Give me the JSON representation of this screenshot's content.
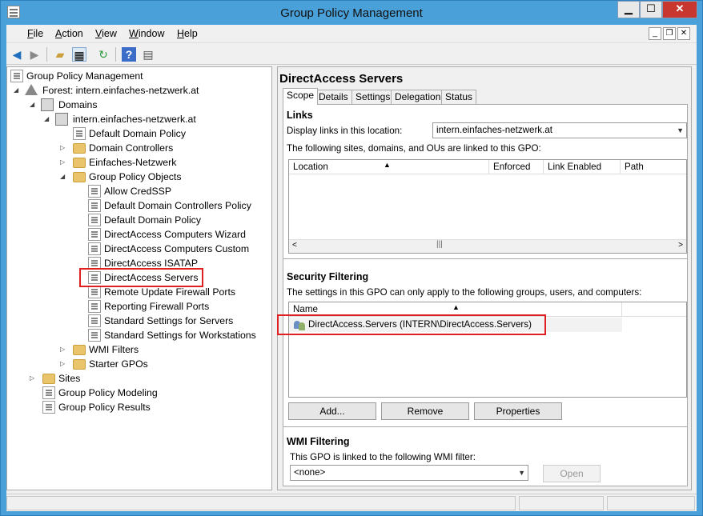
{
  "window": {
    "title": "Group Policy Management",
    "min": "▁",
    "max": "☐",
    "close": "✕"
  },
  "menu": [
    {
      "label": "File",
      "key": "F",
      "rest": "ile"
    },
    {
      "label": "Action",
      "key": "A",
      "rest": "ction"
    },
    {
      "label": "View",
      "key": "V",
      "rest": "iew"
    },
    {
      "label": "Window",
      "key": "W",
      "rest": "indow"
    },
    {
      "label": "Help",
      "key": "H",
      "rest": "elp"
    }
  ],
  "toolbar": {
    "icons": [
      "back-arrow-icon",
      "forward-arrow-icon",
      "up-folder-icon",
      "show-hide-tree-icon",
      "refresh-icon",
      "help-icon",
      "properties-icon"
    ]
  },
  "tree": {
    "root": "Group Policy Management",
    "forest": "Forest: intern.einfaches-netzwerk.at",
    "domains": "Domains",
    "domain": "intern.einfaches-netzwerk.at",
    "default_domain_policy": "Default Domain Policy",
    "domain_controllers": "Domain Controllers",
    "einfaches_netzwerk": "Einfaches-Netzwerk",
    "gpo_container": "Group Policy Objects",
    "gpos": [
      "Allow CredSSP",
      "Default Domain Controllers Policy",
      "Default Domain Policy",
      "DirectAccess Computers Wizard",
      "DirectAccess Computers Custom",
      "DirectAccess ISATAP",
      "DirectAccess Servers",
      "Remote Update Firewall Ports",
      "Reporting Firewall Ports",
      "Standard Settings for Servers",
      "Standard Settings for Workstations"
    ],
    "wmi_filters": "WMI Filters",
    "starter_gpos": "Starter GPOs",
    "sites": "Sites",
    "modeling": "Group Policy Modeling",
    "results": "Group Policy Results"
  },
  "details": {
    "title": "DirectAccess Servers",
    "tabs": [
      "Scope",
      "Details",
      "Settings",
      "Delegation",
      "Status"
    ],
    "links": {
      "heading": "Links",
      "display_label": "Display links in this location:",
      "location_value": "intern.einfaches-netzwerk.at",
      "linked_text": "The following sites, domains, and OUs are linked to this GPO:",
      "columns": [
        "Location",
        "Enforced",
        "Link Enabled",
        "Path"
      ]
    },
    "security": {
      "heading": "Security Filtering",
      "text": "The settings in this GPO can only apply to the following groups, users, and computers:",
      "column": "Name",
      "entries": [
        "DirectAccess.Servers (INTERN\\DirectAccess.Servers)"
      ],
      "add": "Add...",
      "remove": "Remove",
      "properties": "Properties"
    },
    "wmi": {
      "heading": "WMI Filtering",
      "text": "This GPO is linked to the following WMI filter:",
      "value": "<none>",
      "open": "Open"
    }
  }
}
